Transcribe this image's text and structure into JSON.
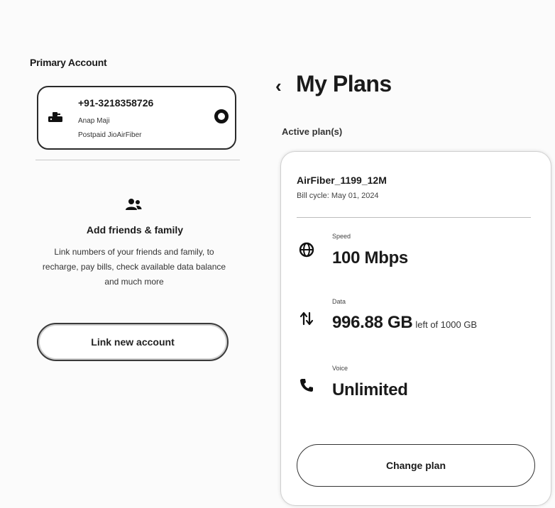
{
  "primary_account": {
    "section_label": "Primary Account",
    "number": "+91-3218358726",
    "name": "Anap Maji",
    "plan_type": "Postpaid JioAirFiber",
    "icon": "router-icon",
    "selected": true
  },
  "add_family": {
    "icon": "people-icon",
    "title": "Add friends & family",
    "description": "Link numbers of your friends and family, to recharge, pay bills, check available data balance and much more",
    "button_label": "Link new account"
  },
  "my_plans": {
    "back_icon": "chevron-left-icon",
    "title": "My Plans",
    "active_label": "Active plan(s)",
    "plan": {
      "name": "AirFiber_1199_12M",
      "bill_cycle": "Bill cycle: May 01, 2024",
      "speed": {
        "label": "Speed",
        "value": "100 Mbps",
        "icon": "globe-icon"
      },
      "data": {
        "label": "Data",
        "value": "996.88 GB",
        "suffix": "left of 1000 GB",
        "icon": "arrows-updown-icon"
      },
      "voice": {
        "label": "Voice",
        "value": "Unlimited",
        "icon": "phone-icon"
      }
    },
    "change_plan_label": "Change plan"
  }
}
